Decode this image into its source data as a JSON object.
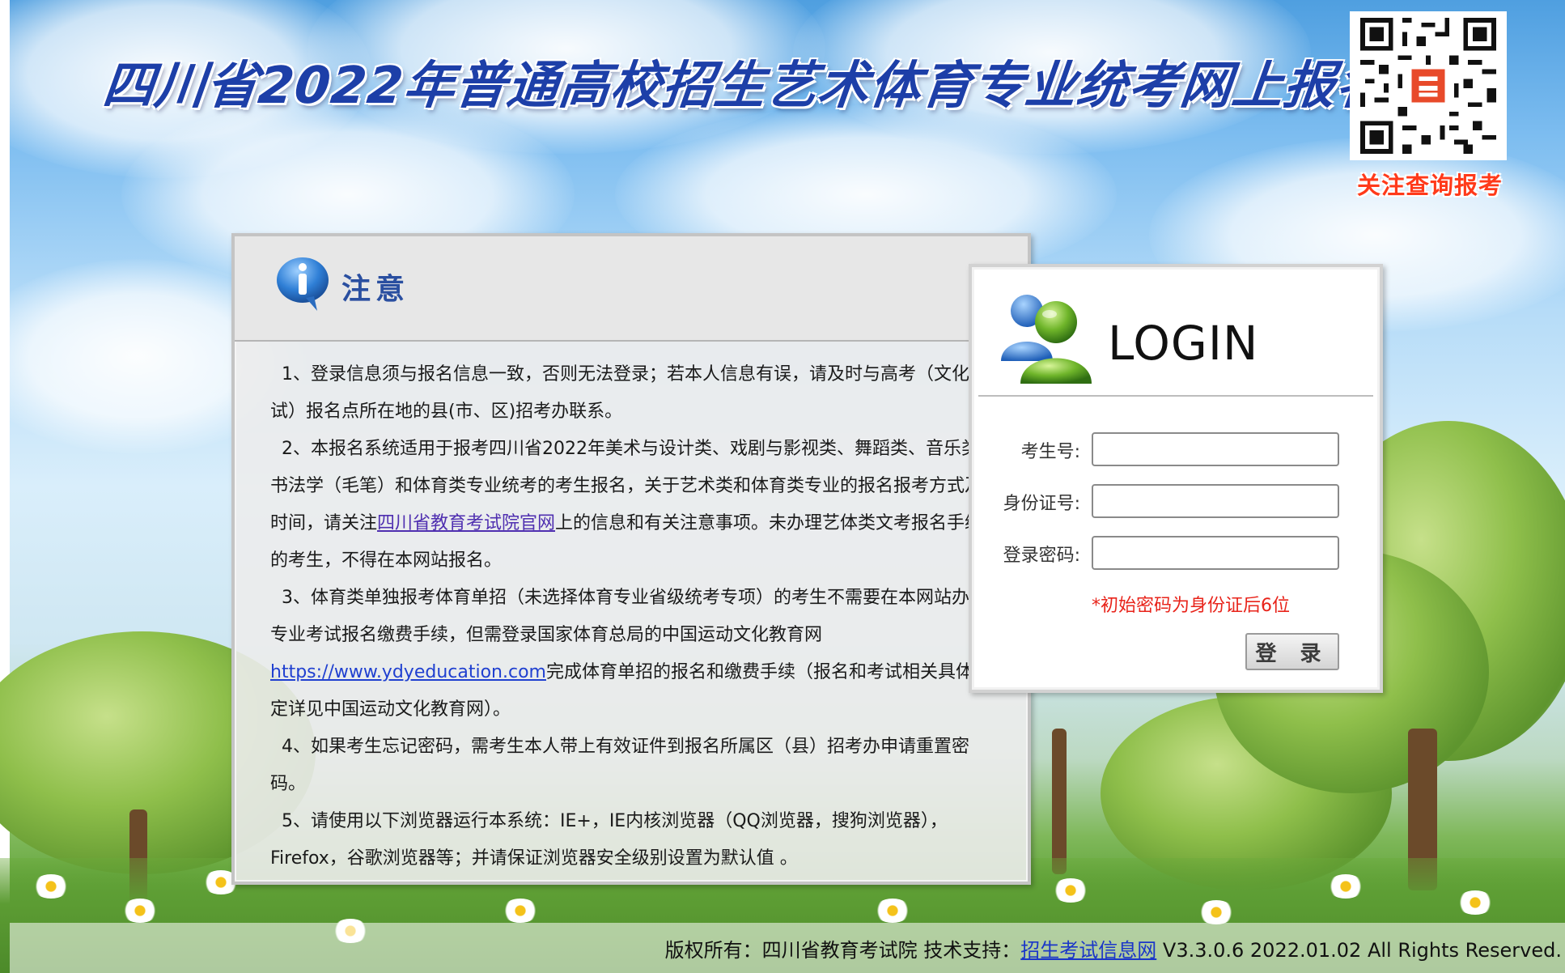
{
  "header": {
    "title": "四川省2022年普通高校招生艺术体育专业统考网上报名系统",
    "qr_caption": "关注查询报考"
  },
  "notice": {
    "title": "注意",
    "items": [
      {
        "before": "1、登录信息须与报名信息一致，否则无法登录；若本人信息有误，请及时与高考（文化考试）报名点所在地的县(市、区)招考办联系。",
        "link": "",
        "after": ""
      },
      {
        "before": "2、本报名系统适用于报考四川省2022年美术与设计类、戏剧与影视类、舞蹈类、音乐类、书法学（毛笔）和体育类专业统考的考生报名，关于艺术类和体育类专业的报名报考方式及时间，请关注",
        "link": "四川省教育考试院官网",
        "after": "上的信息和有关注意事项。未办理艺体类文考报名手续的考生，不得在本网站报名。"
      },
      {
        "before": "3、体育类单独报考体育单招（未选择体育专业省级统考专项）的考生不需要在本网站办理专业考试报名缴费手续，但需登录国家体育总局的中国运动文化教育网",
        "link": "https://www.ydyeducation.com",
        "after": "完成体育单招的报名和缴费手续（报名和考试相关具体规定详见中国运动文化教育网）。"
      },
      {
        "before": "4、如果考生忘记密码，需考生本人带上有效证件到报名所属区（县）招考办申请重置密码。",
        "link": "",
        "after": ""
      },
      {
        "before": "5、请使用以下浏览器运行本系统：IE+，IE内核浏览器（QQ浏览器，搜狗浏览器），Firefox，谷歌浏览器等；并请保证浏览器安全级别设置为默认值 。",
        "link": "",
        "after": ""
      }
    ]
  },
  "login": {
    "title": "LOGIN",
    "exam_no_label": "考生号:",
    "exam_no_value": "",
    "id_label": "身份证号:",
    "id_value": "",
    "password_label": "登录密码:",
    "password_value": "",
    "hint": "*初始密码为身份证后6位",
    "button": "登 录"
  },
  "footer": {
    "copyright": "版权所有：四川省教育考试院 技术支持：",
    "support_link": "招生考试信息网",
    "version": " V3.3.0.6 2022.01.02 All Rights Reserved."
  },
  "colors": {
    "title_blue": "#1d3fa8",
    "hint_red": "#e8231a",
    "link_purple": "#4f2fb0",
    "link_blue": "#1a36c8"
  },
  "icons": [
    "qr-code-icon",
    "info-icon",
    "users-icon"
  ]
}
